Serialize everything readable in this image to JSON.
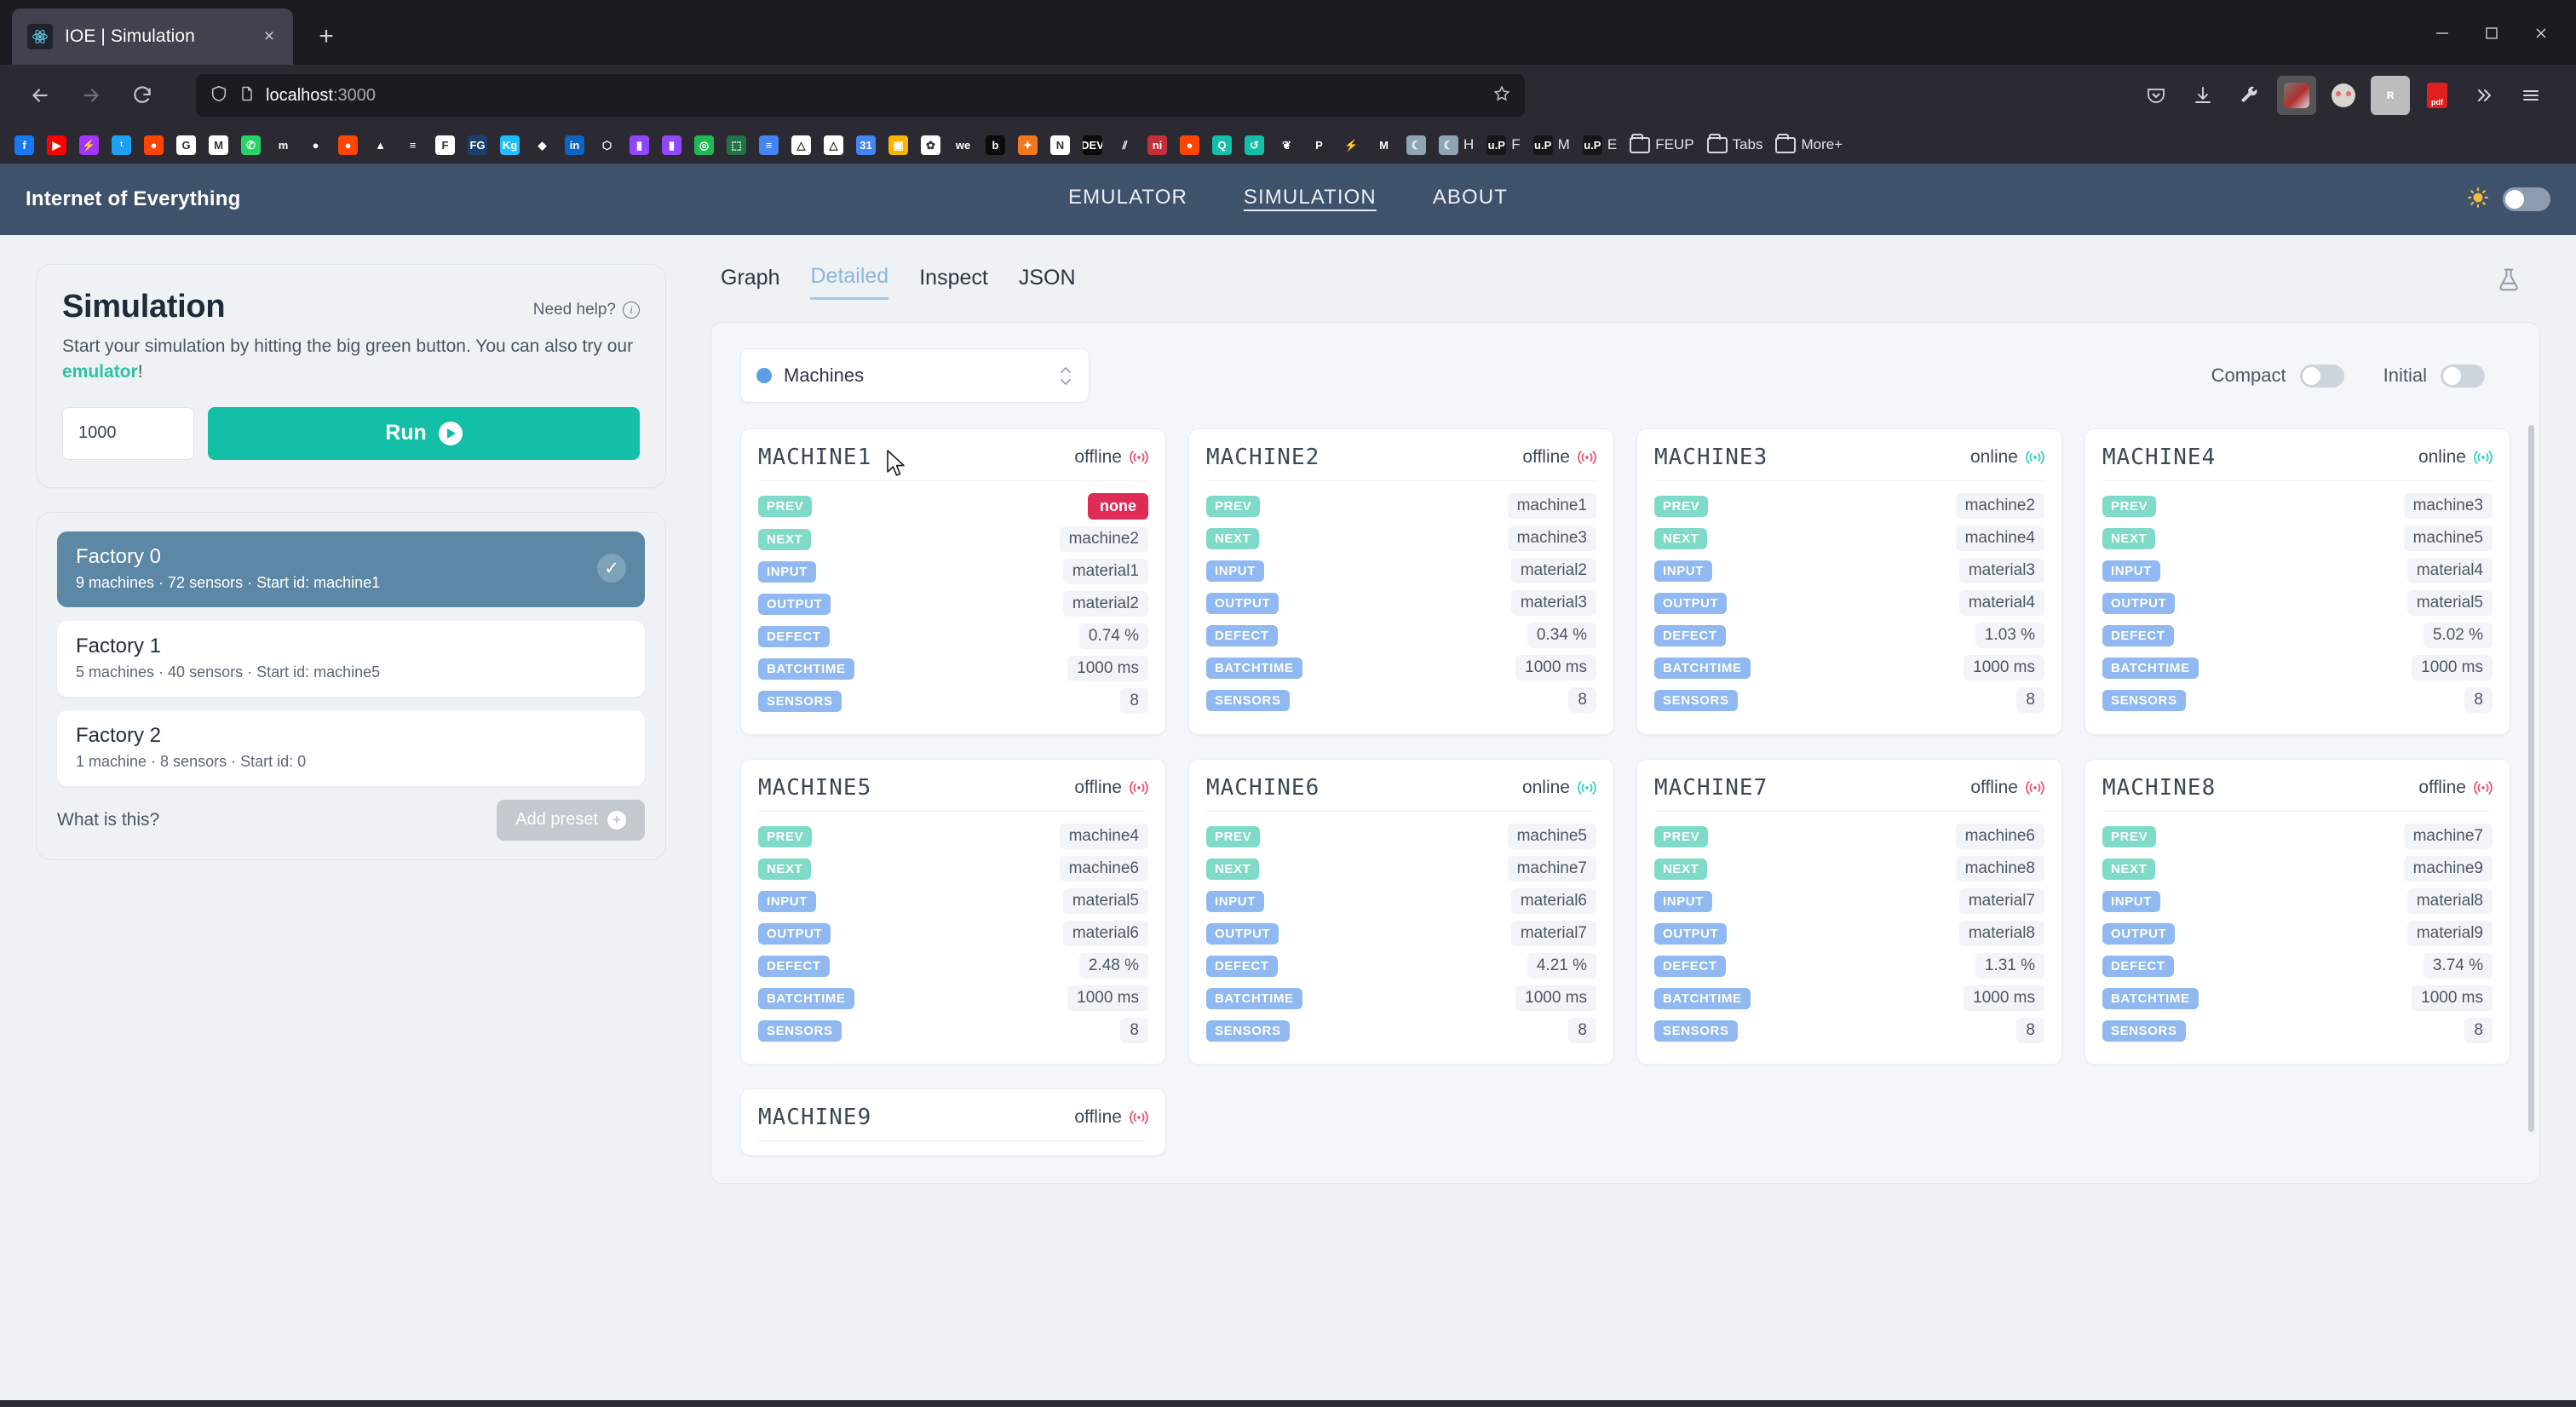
{
  "browser": {
    "tab": {
      "title": "IOE | Simulation",
      "favicon": "react-icon",
      "close": "×"
    },
    "newtab_label": "+",
    "window_controls": {
      "minimize": "—",
      "maximize": "□",
      "close": "✕"
    },
    "nav": {
      "back": "back-icon",
      "forward": "forward-icon",
      "reload": "reload-icon"
    },
    "url": {
      "host": "localhost",
      "port": ":3000",
      "shield": "shield-icon",
      "page": "page-icon",
      "bookmark_star": "star-icon"
    },
    "toolbar_icons": [
      "pocket-icon",
      "downloads-icon",
      "wrench-icon",
      "extension-icon",
      "extension2-icon",
      "extension3-icon",
      "pdf-icon",
      "overflow-icon",
      "menu-icon"
    ],
    "bookmarks": [
      {
        "label": "",
        "icon": "facebook",
        "color": "#1877f2",
        "glyph": "f"
      },
      {
        "label": "",
        "icon": "youtube",
        "color": "#ff0000",
        "glyph": "▶"
      },
      {
        "label": "",
        "icon": "messenger",
        "color": "#a334fa",
        "glyph": "⚡"
      },
      {
        "label": "",
        "icon": "twitter",
        "color": "#1da1f2",
        "glyph": "ᵗ"
      },
      {
        "label": "",
        "icon": "reddit",
        "color": "#ff4500",
        "glyph": "●"
      },
      {
        "label": "",
        "icon": "google",
        "color": "#ffffff",
        "glyph": "G"
      },
      {
        "label": "",
        "icon": "gmail",
        "color": "#ffffff",
        "glyph": "M"
      },
      {
        "label": "",
        "icon": "whatsapp",
        "color": "#25d366",
        "glyph": "✆"
      },
      {
        "label": "",
        "icon": "moodle",
        "color": "#2b2a33",
        "glyph": "m"
      },
      {
        "label": "",
        "icon": "github",
        "color": "#2b2a33",
        "glyph": "●"
      },
      {
        "label": "",
        "icon": "reddit2",
        "color": "#ff4500",
        "glyph": "●"
      },
      {
        "label": "",
        "icon": "gitlab",
        "color": "#2b2a33",
        "glyph": "▲"
      },
      {
        "label": "",
        "icon": "document",
        "color": "#2b2a33",
        "glyph": "≡"
      },
      {
        "label": "",
        "icon": "feup",
        "color": "#ffffff",
        "glyph": "F"
      },
      {
        "label": "",
        "icon": "fg",
        "color": "#1c3f6e",
        "glyph": "FG"
      },
      {
        "label": "",
        "icon": "kaggle",
        "color": "#20beff",
        "glyph": "Kg"
      },
      {
        "label": "",
        "icon": "diamond",
        "color": "#2b2a33",
        "glyph": "◆"
      },
      {
        "label": "",
        "icon": "linkedin",
        "color": "#0a66c2",
        "glyph": "in"
      },
      {
        "label": "",
        "icon": "algolia",
        "color": "#2b2a33",
        "glyph": "⬡"
      },
      {
        "label": "",
        "icon": "twitch",
        "color": "#9146ff",
        "glyph": "▮"
      },
      {
        "label": "",
        "icon": "twitch2",
        "color": "#9146ff",
        "glyph": "▮"
      },
      {
        "label": "",
        "icon": "spotify",
        "color": "#1db954",
        "glyph": "◎"
      },
      {
        "label": "",
        "icon": "excel",
        "color": "#217346",
        "glyph": "⬚"
      },
      {
        "label": "",
        "icon": "docs",
        "color": "#4285f4",
        "glyph": "≡"
      },
      {
        "label": "",
        "icon": "drive",
        "color": "#ffffff",
        "glyph": "△"
      },
      {
        "label": "",
        "icon": "drive2",
        "color": "#ffffff",
        "glyph": "△"
      },
      {
        "label": "",
        "icon": "calendar",
        "color": "#4285f4",
        "glyph": "31"
      },
      {
        "label": "",
        "icon": "slides",
        "color": "#f4b400",
        "glyph": "▣"
      },
      {
        "label": "",
        "icon": "photos",
        "color": "#ffffff",
        "glyph": "✿"
      },
      {
        "label": "",
        "icon": "wetransfer",
        "color": "#2b2a33",
        "glyph": "we"
      },
      {
        "label": "",
        "icon": "bitly",
        "color": "#0b0b0b",
        "glyph": "b"
      },
      {
        "label": "",
        "icon": "kdenlive",
        "color": "#f2781e",
        "glyph": "✦"
      },
      {
        "label": "",
        "icon": "notion",
        "color": "#ffffff",
        "glyph": "N"
      },
      {
        "label": "",
        "icon": "devto",
        "color": "#0a0a0a",
        "glyph": "DEV"
      },
      {
        "label": "",
        "icon": "dev2",
        "color": "#2b2a33",
        "glyph": "⫽"
      },
      {
        "label": "",
        "icon": "nintendo",
        "color": "#c4303a",
        "glyph": "ni"
      },
      {
        "label": "",
        "icon": "reddit3",
        "color": "#ff4500",
        "glyph": "●"
      },
      {
        "label": "",
        "icon": "qr",
        "color": "#13bfa6",
        "glyph": "Q"
      },
      {
        "label": "",
        "icon": "sync",
        "color": "#13bfa6",
        "glyph": "↺"
      },
      {
        "label": "",
        "icon": "leaf",
        "color": "#2b2a33",
        "glyph": "❦"
      },
      {
        "label": "",
        "icon": "paypal",
        "color": "#2b2a33",
        "glyph": "P"
      },
      {
        "label": "",
        "icon": "bolt",
        "color": "#2b2a33",
        "glyph": "⚡"
      },
      {
        "label": "",
        "icon": "medium",
        "color": "#2b2a33",
        "glyph": "M"
      },
      {
        "label": "",
        "icon": "moon",
        "color": "#8fa5b5",
        "glyph": "☾"
      },
      {
        "label": "H",
        "icon": "moon2",
        "color": "#8fa5b5",
        "glyph": "☾"
      },
      {
        "label": "F",
        "icon": "up",
        "color": "#16161a",
        "glyph": "u.P"
      },
      {
        "label": "M",
        "icon": "up2",
        "color": "#16161a",
        "glyph": "u.P"
      },
      {
        "label": "E",
        "icon": "up3",
        "color": "#16161a",
        "glyph": "u.P"
      }
    ],
    "bookmark_folders": [
      "FEUP",
      "Tabs",
      "More+"
    ]
  },
  "header": {
    "brand": "Internet of Everything",
    "nav": [
      {
        "label": "EMULATOR",
        "active": false
      },
      {
        "label": "SIMULATION",
        "active": true
      },
      {
        "label": "ABOUT",
        "active": false
      }
    ],
    "theme_icon": "sun-icon"
  },
  "simulation_panel": {
    "title": "Simulation",
    "need_help": "Need help?",
    "description_part1": "Start your simulation by hitting the big green button. You can also try our ",
    "description_link": "emulator",
    "description_part2": "!",
    "count_value": "1000",
    "run_label": "Run"
  },
  "presets": {
    "items": [
      {
        "name": "Factory 0",
        "sub": "9 machines · 72 sensors · Start id: machine1",
        "selected": true
      },
      {
        "name": "Factory 1",
        "sub": "5 machines · 40 sensors · Start id: machine5",
        "selected": false
      },
      {
        "name": "Factory 2",
        "sub": "1 machine  · 8 sensors · Start id: 0",
        "selected": false
      }
    ],
    "what_is_this": "What is this?",
    "add_preset": "Add preset"
  },
  "view": {
    "tabs": [
      {
        "label": "Graph",
        "active": false
      },
      {
        "label": "Detailed",
        "active": true
      },
      {
        "label": "Inspect",
        "active": false
      },
      {
        "label": "JSON",
        "active": false
      }
    ],
    "flask_icon": "flask-icon",
    "selector": {
      "label": "Machines",
      "dot_color": "#5f9de8"
    },
    "toggles": [
      {
        "label": "Compact",
        "on": false
      },
      {
        "label": "Initial",
        "on": false
      }
    ],
    "row_labels": [
      "PREV",
      "NEXT",
      "INPUT",
      "OUTPUT",
      "DEFECT",
      "BATCHTIME",
      "SENSORS"
    ]
  },
  "machines": [
    {
      "name": "MACHINE1",
      "status": "offline",
      "values": [
        "none",
        "machine2",
        "material1",
        "material2",
        "0.74 %",
        "1000 ms",
        "8"
      ],
      "prev_none": true
    },
    {
      "name": "MACHINE2",
      "status": "offline",
      "values": [
        "machine1",
        "machine3",
        "material2",
        "material3",
        "0.34 %",
        "1000 ms",
        "8"
      ],
      "prev_none": false
    },
    {
      "name": "MACHINE3",
      "status": "online",
      "values": [
        "machine2",
        "machine4",
        "material3",
        "material4",
        "1.03 %",
        "1000 ms",
        "8"
      ],
      "prev_none": false
    },
    {
      "name": "MACHINE4",
      "status": "online",
      "values": [
        "machine3",
        "machine5",
        "material4",
        "material5",
        "5.02 %",
        "1000 ms",
        "8"
      ],
      "prev_none": false
    },
    {
      "name": "MACHINE5",
      "status": "offline",
      "values": [
        "machine4",
        "machine6",
        "material5",
        "material6",
        "2.48 %",
        "1000 ms",
        "8"
      ],
      "prev_none": false
    },
    {
      "name": "MACHINE6",
      "status": "online",
      "values": [
        "machine5",
        "machine7",
        "material6",
        "material7",
        "4.21 %",
        "1000 ms",
        "8"
      ],
      "prev_none": false
    },
    {
      "name": "MACHINE7",
      "status": "offline",
      "values": [
        "machine6",
        "machine8",
        "material7",
        "material8",
        "1.31 %",
        "1000 ms",
        "8"
      ],
      "prev_none": false
    },
    {
      "name": "MACHINE8",
      "status": "offline",
      "values": [
        "machine7",
        "machine9",
        "material8",
        "material9",
        "3.74 %",
        "1000 ms",
        "8"
      ],
      "prev_none": false
    },
    {
      "name": "MACHINE9",
      "status": "offline",
      "values": [],
      "prev_none": false
    }
  ],
  "colors": {
    "accent_green": "#13bfa6",
    "chip_green": "#7fdbc7",
    "chip_blue": "#8fb9f0",
    "danger": "#e02b55",
    "online": "#2ed3bd",
    "offline": "#e8556f",
    "header_bg": "#3f526b",
    "selected_preset": "#5c88a5"
  }
}
